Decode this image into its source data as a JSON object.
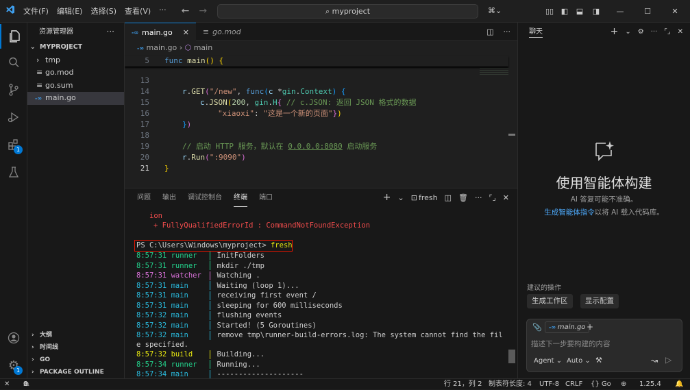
{
  "titlebar": {
    "menu": [
      "文件(F)",
      "编辑(E)",
      "选择(S)",
      "查看(V)",
      "···"
    ],
    "search": "myproject"
  },
  "explorer": {
    "title": "资源管理器",
    "project": "MYPROJECT",
    "items": [
      {
        "label": "tmp",
        "icon": "chevron-right",
        "depth": 1
      },
      {
        "label": "go.mod",
        "icon": "lines",
        "depth": 1
      },
      {
        "label": "go.sum",
        "icon": "lines",
        "depth": 1
      },
      {
        "label": "main.go",
        "icon": "go",
        "depth": 1,
        "selected": true
      }
    ],
    "outline_sections": [
      "大纲",
      "时间线",
      "GO",
      "PACKAGE OUTLINE"
    ]
  },
  "activity_badges": {
    "extensions": "1",
    "accounts": "1"
  },
  "editor": {
    "tabs": [
      {
        "label": "main.go",
        "active": true
      },
      {
        "label": "go.mod",
        "active": false
      }
    ],
    "breadcrumb": {
      "file": "main.go",
      "symbol": "main"
    },
    "sticky": {
      "num": "5",
      "text": "func main() {"
    },
    "lines": [
      {
        "num": "13",
        "text": ""
      },
      {
        "num": "14",
        "text": "r.GET(\"/new\", func(c *gin.Context) {"
      },
      {
        "num": "15",
        "text": "c.JSON(200, gin.H{ // c.JSON: 返回 JSON 格式的数据"
      },
      {
        "num": "16",
        "text": "\"xiaoxi\": \"这是一个新的页面\"})"
      },
      {
        "num": "17",
        "text": "})"
      },
      {
        "num": "18",
        "text": ""
      },
      {
        "num": "19",
        "text": "// 启动 HTTP 服务，默认在 0.0.0.0:8080 启动服务"
      },
      {
        "num": "20",
        "text": "r.Run(\":9090\")"
      },
      {
        "num": "21",
        "text": "}"
      }
    ]
  },
  "panel": {
    "tabs": [
      "问题",
      "输出",
      "调试控制台",
      "终端",
      "端口"
    ],
    "active_tab": "终端",
    "terminal_name": "fresh",
    "error_lines": [
      "ion",
      "+ FullyQualifiedErrorId : CommandNotFoundException"
    ],
    "prompt": "PS C:\\Users\\Windows\\myproject>",
    "command": "fresh",
    "log": [
      {
        "time": "8:57:31",
        "src": "runner",
        "msg": "InitFolders",
        "color": "#23d18b",
        "bar": "#23d18b"
      },
      {
        "time": "8:57:31",
        "src": "runner",
        "msg": "mkdir ./tmp",
        "color": "#23d18b",
        "bar": "#23d18b"
      },
      {
        "time": "8:57:31",
        "src": "watcher",
        "msg": "Watching .",
        "color": "#d670d6",
        "bar": "#d670d6"
      },
      {
        "time": "8:57:31",
        "src": "main",
        "msg": "Waiting (loop 1)...",
        "color": "#29b8db",
        "bar": "#29b8db"
      },
      {
        "time": "8:57:31",
        "src": "main",
        "msg": "receiving first event /",
        "color": "#29b8db",
        "bar": "#29b8db"
      },
      {
        "time": "8:57:31",
        "src": "main",
        "msg": "sleeping for 600 milliseconds",
        "color": "#29b8db",
        "bar": "#29b8db"
      },
      {
        "time": "8:57:32",
        "src": "main",
        "msg": "flushing events",
        "color": "#29b8db",
        "bar": "#29b8db"
      },
      {
        "time": "8:57:32",
        "src": "main",
        "msg": "Started! (5 Goroutines)",
        "color": "#29b8db",
        "bar": "#29b8db"
      },
      {
        "time": "8:57:32",
        "src": "main",
        "msg": "remove tmp\\runner-build-errors.log: The system cannot find the fil",
        "color": "#29b8db",
        "bar": "#29b8db"
      }
    ],
    "wrap_line": "e specified.",
    "log2": [
      {
        "time": "8:57:32",
        "src": "build",
        "msg": "Building...",
        "color": "#e5e510",
        "bar": "#e5e510"
      },
      {
        "time": "8:57:34",
        "src": "runner",
        "msg": "Running...",
        "color": "#23d18b",
        "bar": "#23d18b"
      },
      {
        "time": "8:57:34",
        "src": "main",
        "msg": "--------------------",
        "color": "#29b8db",
        "bar": "#29b8db"
      }
    ]
  },
  "chat": {
    "title": "聊天",
    "heading": "使用智能体构建",
    "sub": "AI 答复可能不准确。",
    "link": "生成智能体指令",
    "link_suffix": "以将 AI 载入代码库。",
    "suggest_title": "建议的操作",
    "suggest": [
      "生成工作区",
      "显示配置"
    ],
    "context_file": "main.go",
    "placeholder": "描述下一步要构建的内容",
    "mode": "Agent",
    "model": "Auto"
  },
  "status": {
    "errors": "0",
    "warnings": "0",
    "position": "行 21，列 2",
    "tab": "制表符长度: 4",
    "encoding": "UTF-8",
    "eol": "CRLF",
    "lang": "{} Go",
    "version": "1.25.4"
  }
}
